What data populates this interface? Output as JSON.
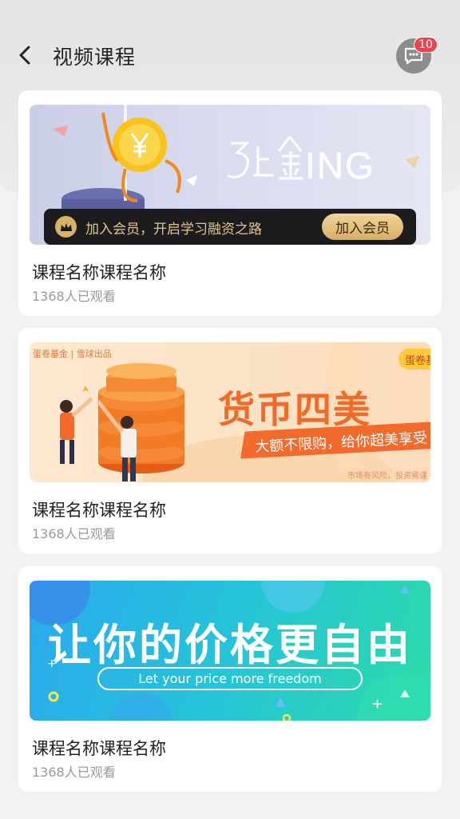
{
  "header": {
    "title": "视频课程",
    "message_badge": "10"
  },
  "courses": [
    {
      "name": "课程名称课程名称",
      "views": "1368人已观看",
      "banner": {
        "headline": "马上金ING",
        "vip_text": "加入会员，开启学习融资之路",
        "vip_button": "加入会员"
      }
    },
    {
      "name": "课程名称课程名称",
      "views": "1368人已观看",
      "banner": {
        "brand": "蛋卷基金 | 雪球出品",
        "tag": "蛋卷基",
        "headline": "货币四美",
        "subline": "大额不限购，给你超美享受",
        "risk": "市场有风险，投资需谨"
      }
    },
    {
      "name": "课程名称课程名称",
      "views": "1368人已观看",
      "banner": {
        "headline": "让你的价格更自由",
        "subline": "Let your price more freedom"
      }
    }
  ],
  "colors": {
    "badge": "#f0444d",
    "vip_gold": "#e6c488",
    "orange": "#f06a2a"
  },
  "icons": [
    "back-arrow-icon",
    "message-icon",
    "crown-icon"
  ]
}
